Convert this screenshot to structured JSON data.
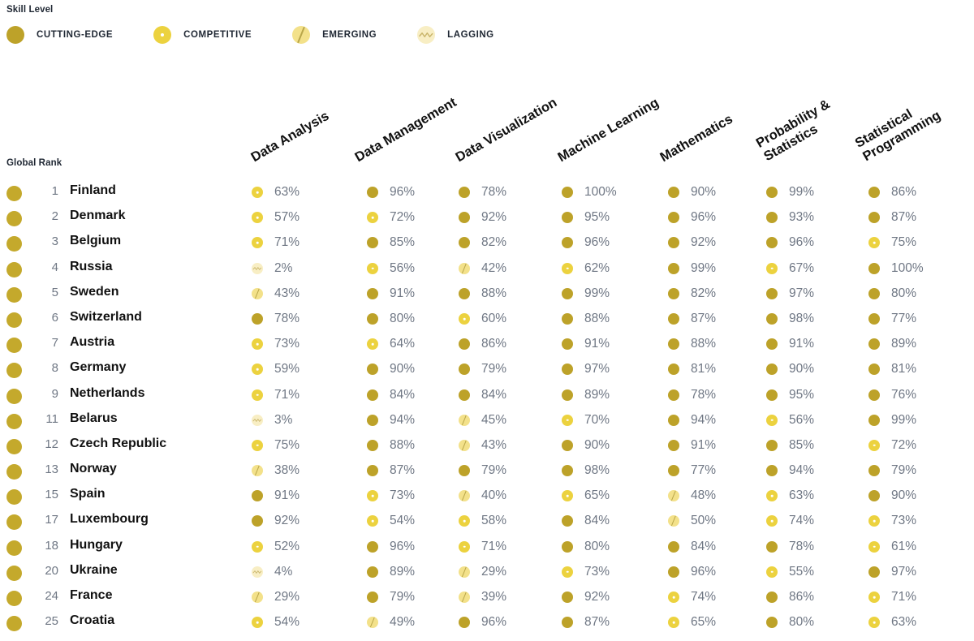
{
  "legend": {
    "title": "Skill Level",
    "items": [
      {
        "label": "CUTTING-EDGE",
        "key": "cutting-edge",
        "icon": "solid-circle-icon",
        "color": "#bda229"
      },
      {
        "label": "COMPETITIVE",
        "key": "competitive",
        "icon": "dotted-circle-icon",
        "color": "#ecd23f"
      },
      {
        "label": "EMERGING",
        "key": "emerging",
        "icon": "slashed-circle-icon",
        "color": "#f3e18a"
      },
      {
        "label": "LAGGING",
        "key": "lagging",
        "icon": "wavy-circle-icon",
        "color": "#f8eec4"
      }
    ]
  },
  "table": {
    "rank_header": "Global Rank",
    "columns": [
      {
        "label": "Data Analysis",
        "lines": [
          "Data Analysis"
        ]
      },
      {
        "label": "Data Management",
        "lines": [
          "Data Management"
        ]
      },
      {
        "label": "Data Visualization",
        "lines": [
          "Data Visualization"
        ]
      },
      {
        "label": "Machine Learning",
        "lines": [
          "Machine Learning"
        ]
      },
      {
        "label": "Mathematics",
        "lines": [
          "Mathematics"
        ]
      },
      {
        "label": "Probability & Statistics",
        "lines": [
          "Probability &",
          "Statistics"
        ]
      },
      {
        "label": "Statistical Programming",
        "lines": [
          "Statistical",
          "Programming"
        ]
      }
    ],
    "rows": [
      {
        "rank": "1",
        "country": "Finland",
        "cells": [
          {
            "value": "63%",
            "level": "competitive"
          },
          {
            "value": "96%",
            "level": "cutting-edge"
          },
          {
            "value": "78%",
            "level": "cutting-edge"
          },
          {
            "value": "100%",
            "level": "cutting-edge"
          },
          {
            "value": "90%",
            "level": "cutting-edge"
          },
          {
            "value": "99%",
            "level": "cutting-edge"
          },
          {
            "value": "86%",
            "level": "cutting-edge"
          }
        ]
      },
      {
        "rank": "2",
        "country": "Denmark",
        "cells": [
          {
            "value": "57%",
            "level": "competitive"
          },
          {
            "value": "72%",
            "level": "competitive"
          },
          {
            "value": "92%",
            "level": "cutting-edge"
          },
          {
            "value": "95%",
            "level": "cutting-edge"
          },
          {
            "value": "96%",
            "level": "cutting-edge"
          },
          {
            "value": "93%",
            "level": "cutting-edge"
          },
          {
            "value": "87%",
            "level": "cutting-edge"
          }
        ]
      },
      {
        "rank": "3",
        "country": "Belgium",
        "cells": [
          {
            "value": "71%",
            "level": "competitive"
          },
          {
            "value": "85%",
            "level": "cutting-edge"
          },
          {
            "value": "82%",
            "level": "cutting-edge"
          },
          {
            "value": "96%",
            "level": "cutting-edge"
          },
          {
            "value": "92%",
            "level": "cutting-edge"
          },
          {
            "value": "96%",
            "level": "cutting-edge"
          },
          {
            "value": "75%",
            "level": "competitive"
          }
        ]
      },
      {
        "rank": "4",
        "country": "Russia",
        "cells": [
          {
            "value": "2%",
            "level": "lagging"
          },
          {
            "value": "56%",
            "level": "competitive"
          },
          {
            "value": "42%",
            "level": "emerging"
          },
          {
            "value": "62%",
            "level": "competitive"
          },
          {
            "value": "99%",
            "level": "cutting-edge"
          },
          {
            "value": "67%",
            "level": "competitive"
          },
          {
            "value": "100%",
            "level": "cutting-edge"
          }
        ]
      },
      {
        "rank": "5",
        "country": "Sweden",
        "cells": [
          {
            "value": "43%",
            "level": "emerging"
          },
          {
            "value": "91%",
            "level": "cutting-edge"
          },
          {
            "value": "88%",
            "level": "cutting-edge"
          },
          {
            "value": "99%",
            "level": "cutting-edge"
          },
          {
            "value": "82%",
            "level": "cutting-edge"
          },
          {
            "value": "97%",
            "level": "cutting-edge"
          },
          {
            "value": "80%",
            "level": "cutting-edge"
          }
        ]
      },
      {
        "rank": "6",
        "country": "Switzerland",
        "cells": [
          {
            "value": "78%",
            "level": "cutting-edge"
          },
          {
            "value": "80%",
            "level": "cutting-edge"
          },
          {
            "value": "60%",
            "level": "competitive"
          },
          {
            "value": "88%",
            "level": "cutting-edge"
          },
          {
            "value": "87%",
            "level": "cutting-edge"
          },
          {
            "value": "98%",
            "level": "cutting-edge"
          },
          {
            "value": "77%",
            "level": "cutting-edge"
          }
        ]
      },
      {
        "rank": "7",
        "country": "Austria",
        "cells": [
          {
            "value": "73%",
            "level": "competitive"
          },
          {
            "value": "64%",
            "level": "competitive"
          },
          {
            "value": "86%",
            "level": "cutting-edge"
          },
          {
            "value": "91%",
            "level": "cutting-edge"
          },
          {
            "value": "88%",
            "level": "cutting-edge"
          },
          {
            "value": "91%",
            "level": "cutting-edge"
          },
          {
            "value": "89%",
            "level": "cutting-edge"
          }
        ]
      },
      {
        "rank": "8",
        "country": "Germany",
        "cells": [
          {
            "value": "59%",
            "level": "competitive"
          },
          {
            "value": "90%",
            "level": "cutting-edge"
          },
          {
            "value": "79%",
            "level": "cutting-edge"
          },
          {
            "value": "97%",
            "level": "cutting-edge"
          },
          {
            "value": "81%",
            "level": "cutting-edge"
          },
          {
            "value": "90%",
            "level": "cutting-edge"
          },
          {
            "value": "81%",
            "level": "cutting-edge"
          }
        ]
      },
      {
        "rank": "9",
        "country": "Netherlands",
        "cells": [
          {
            "value": "71%",
            "level": "competitive"
          },
          {
            "value": "84%",
            "level": "cutting-edge"
          },
          {
            "value": "84%",
            "level": "cutting-edge"
          },
          {
            "value": "89%",
            "level": "cutting-edge"
          },
          {
            "value": "78%",
            "level": "cutting-edge"
          },
          {
            "value": "95%",
            "level": "cutting-edge"
          },
          {
            "value": "76%",
            "level": "cutting-edge"
          }
        ]
      },
      {
        "rank": "11",
        "country": "Belarus",
        "cells": [
          {
            "value": "3%",
            "level": "lagging"
          },
          {
            "value": "94%",
            "level": "cutting-edge"
          },
          {
            "value": "45%",
            "level": "emerging"
          },
          {
            "value": "70%",
            "level": "competitive"
          },
          {
            "value": "94%",
            "level": "cutting-edge"
          },
          {
            "value": "56%",
            "level": "competitive"
          },
          {
            "value": "99%",
            "level": "cutting-edge"
          }
        ]
      },
      {
        "rank": "12",
        "country": "Czech Republic",
        "cells": [
          {
            "value": "75%",
            "level": "competitive"
          },
          {
            "value": "88%",
            "level": "cutting-edge"
          },
          {
            "value": "43%",
            "level": "emerging"
          },
          {
            "value": "90%",
            "level": "cutting-edge"
          },
          {
            "value": "91%",
            "level": "cutting-edge"
          },
          {
            "value": "85%",
            "level": "cutting-edge"
          },
          {
            "value": "72%",
            "level": "competitive"
          }
        ]
      },
      {
        "rank": "13",
        "country": "Norway",
        "cells": [
          {
            "value": "38%",
            "level": "emerging"
          },
          {
            "value": "87%",
            "level": "cutting-edge"
          },
          {
            "value": "79%",
            "level": "cutting-edge"
          },
          {
            "value": "98%",
            "level": "cutting-edge"
          },
          {
            "value": "77%",
            "level": "cutting-edge"
          },
          {
            "value": "94%",
            "level": "cutting-edge"
          },
          {
            "value": "79%",
            "level": "cutting-edge"
          }
        ]
      },
      {
        "rank": "15",
        "country": "Spain",
        "cells": [
          {
            "value": "91%",
            "level": "cutting-edge"
          },
          {
            "value": "73%",
            "level": "competitive"
          },
          {
            "value": "40%",
            "level": "emerging"
          },
          {
            "value": "65%",
            "level": "competitive"
          },
          {
            "value": "48%",
            "level": "emerging"
          },
          {
            "value": "63%",
            "level": "competitive"
          },
          {
            "value": "90%",
            "level": "cutting-edge"
          }
        ]
      },
      {
        "rank": "17",
        "country": "Luxembourg",
        "cells": [
          {
            "value": "92%",
            "level": "cutting-edge"
          },
          {
            "value": "54%",
            "level": "competitive"
          },
          {
            "value": "58%",
            "level": "competitive"
          },
          {
            "value": "84%",
            "level": "cutting-edge"
          },
          {
            "value": "50%",
            "level": "emerging"
          },
          {
            "value": "74%",
            "level": "competitive"
          },
          {
            "value": "73%",
            "level": "competitive"
          }
        ]
      },
      {
        "rank": "18",
        "country": "Hungary",
        "cells": [
          {
            "value": "52%",
            "level": "competitive"
          },
          {
            "value": "96%",
            "level": "cutting-edge"
          },
          {
            "value": "71%",
            "level": "competitive"
          },
          {
            "value": "80%",
            "level": "cutting-edge"
          },
          {
            "value": "84%",
            "level": "cutting-edge"
          },
          {
            "value": "78%",
            "level": "cutting-edge"
          },
          {
            "value": "61%",
            "level": "competitive"
          }
        ]
      },
      {
        "rank": "20",
        "country": "Ukraine",
        "cells": [
          {
            "value": "4%",
            "level": "lagging"
          },
          {
            "value": "89%",
            "level": "cutting-edge"
          },
          {
            "value": "29%",
            "level": "emerging"
          },
          {
            "value": "73%",
            "level": "competitive"
          },
          {
            "value": "96%",
            "level": "cutting-edge"
          },
          {
            "value": "55%",
            "level": "competitive"
          },
          {
            "value": "97%",
            "level": "cutting-edge"
          }
        ]
      },
      {
        "rank": "24",
        "country": "France",
        "cells": [
          {
            "value": "29%",
            "level": "emerging"
          },
          {
            "value": "79%",
            "level": "cutting-edge"
          },
          {
            "value": "39%",
            "level": "emerging"
          },
          {
            "value": "92%",
            "level": "cutting-edge"
          },
          {
            "value": "74%",
            "level": "competitive"
          },
          {
            "value": "86%",
            "level": "cutting-edge"
          },
          {
            "value": "71%",
            "level": "competitive"
          }
        ]
      },
      {
        "rank": "25",
        "country": "Croatia",
        "cells": [
          {
            "value": "54%",
            "level": "competitive"
          },
          {
            "value": "49%",
            "level": "emerging"
          },
          {
            "value": "96%",
            "level": "cutting-edge"
          },
          {
            "value": "87%",
            "level": "cutting-edge"
          },
          {
            "value": "65%",
            "level": "competitive"
          },
          {
            "value": "80%",
            "level": "cutting-edge"
          },
          {
            "value": "63%",
            "level": "competitive"
          }
        ]
      }
    ]
  },
  "chart_data": {
    "type": "heatmap",
    "title": "Skill Level",
    "xlabel": "",
    "ylabel": "Global Rank",
    "legend_position": "top-left",
    "grid": false,
    "categories": [
      "Data Analysis",
      "Data Management",
      "Data Visualization",
      "Machine Learning",
      "Mathematics",
      "Probability & Statistics",
      "Statistical Programming"
    ],
    "levels": [
      "CUTTING-EDGE",
      "COMPETITIVE",
      "EMERGING",
      "LAGGING"
    ],
    "level_colors": {
      "CUTTING-EDGE": "#bda229",
      "COMPETITIVE": "#ecd23f",
      "EMERGING": "#f3e18a",
      "LAGGING": "#f8eec4"
    },
    "rows": [
      {
        "rank": 1,
        "country": "Finland",
        "values": [
          63,
          96,
          78,
          100,
          90,
          99,
          86
        ]
      },
      {
        "rank": 2,
        "country": "Denmark",
        "values": [
          57,
          72,
          92,
          95,
          96,
          93,
          87
        ]
      },
      {
        "rank": 3,
        "country": "Belgium",
        "values": [
          71,
          85,
          82,
          96,
          92,
          96,
          75
        ]
      },
      {
        "rank": 4,
        "country": "Russia",
        "values": [
          2,
          56,
          42,
          62,
          99,
          67,
          100
        ]
      },
      {
        "rank": 5,
        "country": "Sweden",
        "values": [
          43,
          91,
          88,
          99,
          82,
          97,
          80
        ]
      },
      {
        "rank": 6,
        "country": "Switzerland",
        "values": [
          78,
          80,
          60,
          88,
          87,
          98,
          77
        ]
      },
      {
        "rank": 7,
        "country": "Austria",
        "values": [
          73,
          64,
          86,
          91,
          88,
          91,
          89
        ]
      },
      {
        "rank": 8,
        "country": "Germany",
        "values": [
          59,
          90,
          79,
          97,
          81,
          90,
          81
        ]
      },
      {
        "rank": 9,
        "country": "Netherlands",
        "values": [
          71,
          84,
          84,
          89,
          78,
          95,
          76
        ]
      },
      {
        "rank": 11,
        "country": "Belarus",
        "values": [
          3,
          94,
          45,
          70,
          94,
          56,
          99
        ]
      },
      {
        "rank": 12,
        "country": "Czech Republic",
        "values": [
          75,
          88,
          43,
          90,
          91,
          85,
          72
        ]
      },
      {
        "rank": 13,
        "country": "Norway",
        "values": [
          38,
          87,
          79,
          98,
          77,
          94,
          79
        ]
      },
      {
        "rank": 15,
        "country": "Spain",
        "values": [
          91,
          73,
          40,
          65,
          48,
          63,
          90
        ]
      },
      {
        "rank": 17,
        "country": "Luxembourg",
        "values": [
          92,
          54,
          58,
          84,
          50,
          74,
          73
        ]
      },
      {
        "rank": 18,
        "country": "Hungary",
        "values": [
          52,
          96,
          71,
          80,
          84,
          78,
          61
        ]
      },
      {
        "rank": 20,
        "country": "Ukraine",
        "values": [
          4,
          89,
          29,
          73,
          96,
          55,
          97
        ]
      },
      {
        "rank": 24,
        "country": "France",
        "values": [
          29,
          79,
          39,
          92,
          74,
          86,
          71
        ]
      },
      {
        "rank": 25,
        "country": "Croatia",
        "values": [
          54,
          49,
          96,
          87,
          65,
          80,
          63
        ]
      }
    ]
  }
}
